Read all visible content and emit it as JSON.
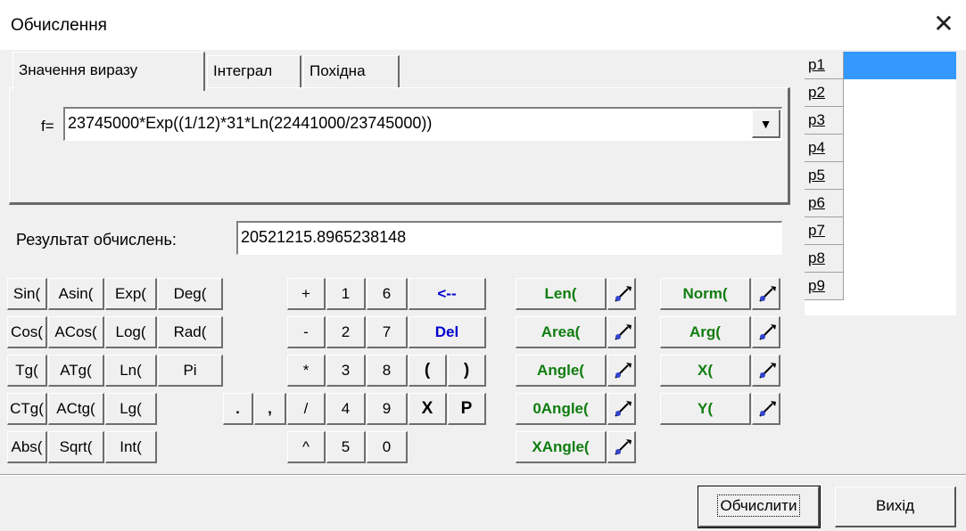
{
  "window": {
    "title": "Обчислення"
  },
  "tabs": [
    {
      "label": "Значення виразу"
    },
    {
      "label": "Інтеграл"
    },
    {
      "label": "Похідна"
    }
  ],
  "expression": {
    "label": "f=",
    "value": "23745000*Exp((1/12)*31*Ln(22441000/23745000))"
  },
  "result": {
    "label": "Результат обчислень:",
    "value": "20521215.8965238148"
  },
  "keypad": {
    "functions": [
      "Sin(",
      "Asin(",
      "Exp(",
      "Deg(",
      "Cos(",
      "ACos(",
      "Log(",
      "Rad(",
      "Tg(",
      "ATg(",
      "Ln(",
      "Pi",
      "CTg(",
      "ACtg(",
      "Lg(",
      "Abs(",
      "Sqrt(",
      "Int("
    ],
    "dot": ".",
    "comma": ",",
    "operators": [
      "+",
      "-",
      "*",
      "/",
      "^"
    ],
    "digits": [
      "1",
      "2",
      "3",
      "4",
      "5",
      "6",
      "7",
      "8",
      "9",
      "0"
    ],
    "backspace": "<--",
    "delete": "Del",
    "lparen": "(",
    "rparen": ")",
    "x": "X",
    "p": "P"
  },
  "geometry_functions": [
    "Len(",
    "Area(",
    "Angle(",
    "0Angle(",
    "XAngle("
  ],
  "vector_functions": [
    "Norm(",
    "Arg(",
    "X(",
    "Y("
  ],
  "params": [
    "p1",
    "p2",
    "p3",
    "p4",
    "p5",
    "p6",
    "p7",
    "p8",
    "p9"
  ],
  "actions": {
    "compute": "Обчислити",
    "exit": "Вихід"
  },
  "icons": {
    "close": "close-icon",
    "dropdown": "chevron-down-icon",
    "pick": "point-picker-icon"
  },
  "colors": {
    "green_text": "#0f7d0f",
    "blue_text": "#0000d0",
    "selection": "#3399ff"
  }
}
